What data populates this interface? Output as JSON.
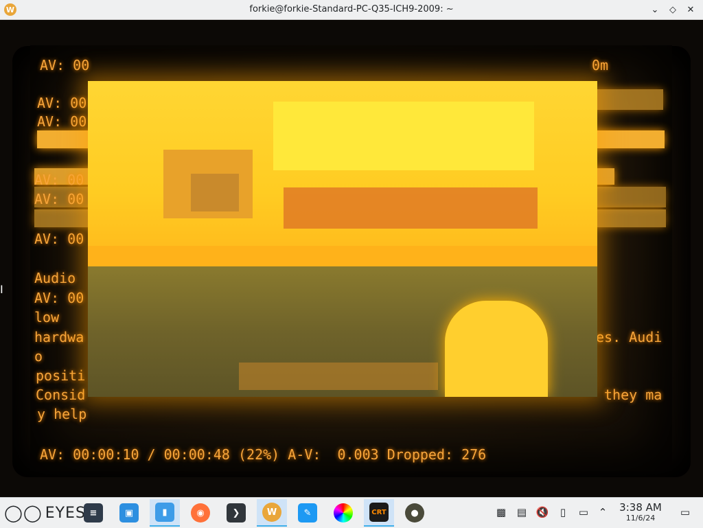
{
  "window": {
    "title": "forkie@forkie-Standard-PC-Q35-ICH9-2009: ~",
    "app_icon": "W",
    "buttons": [
      "chevron-down-icon",
      "maximize-icon",
      "close-icon"
    ]
  },
  "terminal": {
    "lines": [
      {
        "id": "l1",
        "text": "AV: 00"
      },
      {
        "id": "l1r",
        "text": "0m"
      },
      {
        "id": "l2",
        "text": "AV: 00"
      },
      {
        "id": "l3",
        "text": "AV: 00"
      },
      {
        "id": "l4",
        "text": "AV: 00"
      },
      {
        "id": "l5",
        "text": "AV: 00"
      },
      {
        "id": "l6",
        "text": "AV: 00"
      },
      {
        "id": "l7",
        "text": "Audio"
      },
      {
        "id": "l8",
        "text": "AV: 00"
      },
      {
        "id": "l9",
        "text": "low"
      },
      {
        "id": "l10",
        "text": "hardwa"
      },
      {
        "id": "l10r",
        "text": "es. Audi"
      },
      {
        "id": "l11",
        "text": "o"
      },
      {
        "id": "l12",
        "text": "positi"
      },
      {
        "id": "l13",
        "text": "Consid"
      },
      {
        "id": "l13r",
        "text": "they ma"
      },
      {
        "id": "l14",
        "text": "y help"
      }
    ],
    "status": "AV: 00:00:10 / 00:00:48 (22%) A-V:  0.003 Dropped: 276"
  },
  "taskbar": {
    "launcher": "EYES",
    "apps": [
      {
        "name": "settings-app",
        "label": ""
      },
      {
        "name": "discover-app",
        "label": ""
      },
      {
        "name": "file-manager-app",
        "label": ""
      },
      {
        "name": "firefox-app",
        "label": ""
      },
      {
        "name": "terminal-app",
        "label": ""
      },
      {
        "name": "w-app",
        "label": "W"
      },
      {
        "name": "kate-app",
        "label": ""
      },
      {
        "name": "color-app",
        "label": ""
      },
      {
        "name": "crt-app",
        "label": "CRT"
      },
      {
        "name": "media-app",
        "label": ""
      }
    ],
    "clock": {
      "time": "3:38 AM",
      "date": "11/6/24"
    }
  },
  "colors": {
    "amber": "#f7a53b",
    "accent": "#3daee9",
    "panel": "#eff0f1"
  }
}
